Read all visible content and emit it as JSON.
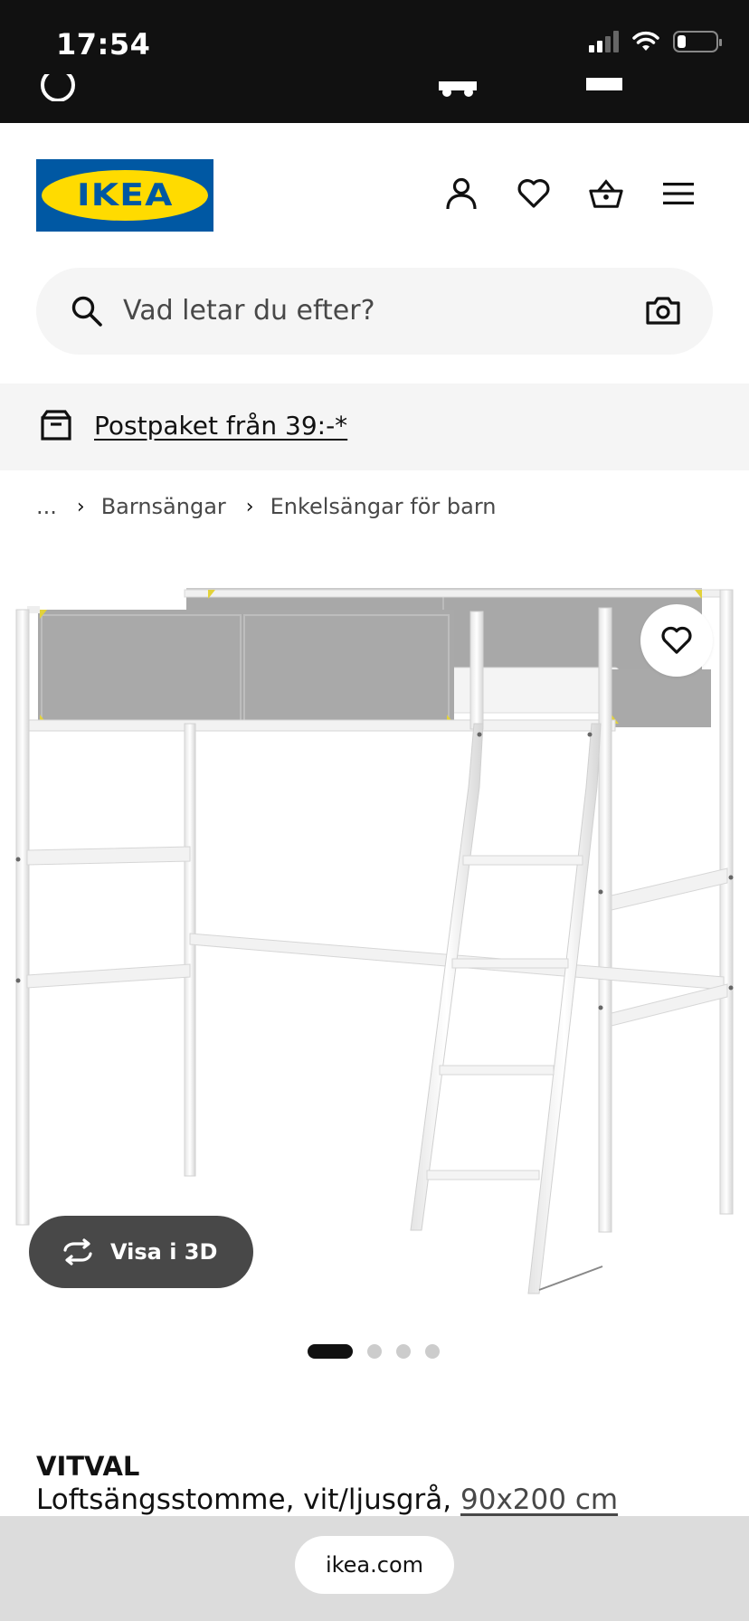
{
  "status_bar": {
    "time": "17:54"
  },
  "header": {
    "logo_text": "IKEA",
    "icons": [
      "user-icon",
      "heart-icon",
      "basket-icon",
      "menu-icon"
    ]
  },
  "search": {
    "placeholder": "Vad letar du efter?"
  },
  "banner": {
    "text": "Postpaket från 39:-*"
  },
  "breadcrumb": {
    "ellipsis": "...",
    "items": [
      "Barnsängar",
      "Enkelsängar för barn"
    ]
  },
  "gallery": {
    "view_3d_label": "Visa i 3D",
    "page_count": 4,
    "active_index": 0
  },
  "product": {
    "name": "VITVAL",
    "description": "Loftsängsstomme, vit/ljusgrå,",
    "size": "90x200 cm"
  },
  "browser": {
    "url": "ikea.com"
  },
  "colors": {
    "ikea_blue": "#0058a3",
    "ikea_yellow": "#ffdb00",
    "dark_pill": "#484848"
  }
}
